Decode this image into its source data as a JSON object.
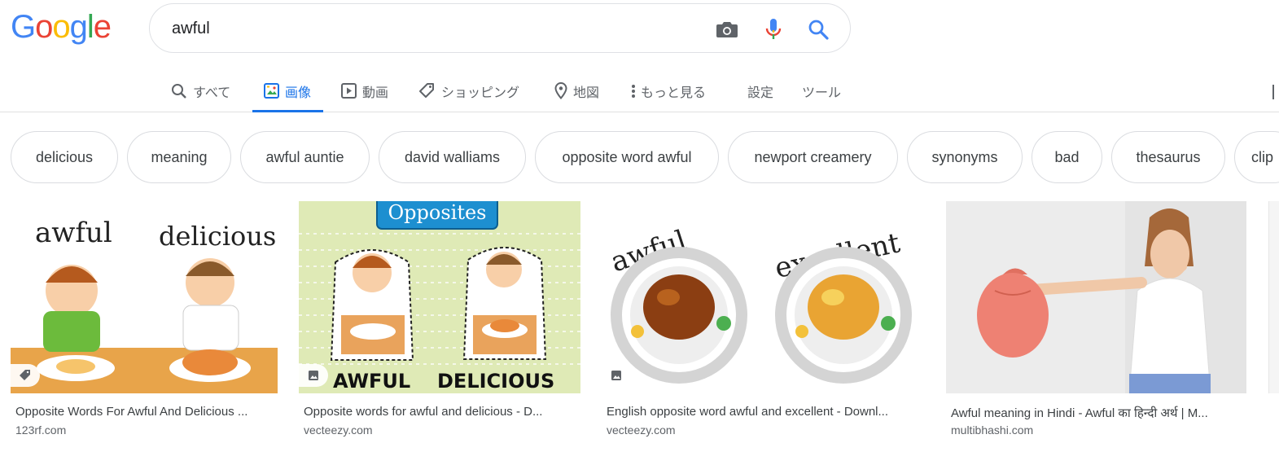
{
  "logo": {
    "letters": [
      "G",
      "o",
      "o",
      "g",
      "l",
      "e"
    ],
    "colors": [
      "#4285F4",
      "#EA4335",
      "#FBBC05",
      "#4285F4",
      "#34A853",
      "#EA4335"
    ]
  },
  "search": {
    "value": "awful",
    "icons": [
      "camera-icon",
      "microphone-icon",
      "search-icon"
    ]
  },
  "tabs": [
    {
      "label": "すべて",
      "icon": "search-icon"
    },
    {
      "label": "画像",
      "icon": "image-icon",
      "active": true
    },
    {
      "label": "動画",
      "icon": "video-icon"
    },
    {
      "label": "ショッピング",
      "icon": "tag-icon"
    },
    {
      "label": "地図",
      "icon": "map-pin-icon"
    },
    {
      "label": "もっと見る",
      "icon": "more-vert-icon"
    },
    {
      "label": "設定"
    },
    {
      "label": "ツール"
    }
  ],
  "chips": [
    "delicious",
    "meaning",
    "awful auntie",
    "david walliams",
    "opposite word awful",
    "newport creamery",
    "synonyms",
    "bad",
    "thesaurus",
    "clip"
  ],
  "results": [
    {
      "title": "Opposite Words For Awful And Delicious ...",
      "source": "123rf.com",
      "badge": "tag-icon",
      "image_text": [
        "awful",
        "delicious"
      ]
    },
    {
      "title": "Opposite words for awful and delicious - D...",
      "source": "vecteezy.com",
      "badge": "image-icon",
      "image_text": [
        "Opposites",
        "AWFUL",
        "DELICIOUS"
      ]
    },
    {
      "title": "English opposite word awful and excellent - Downl...",
      "source": "vecteezy.com",
      "badge": "image-icon",
      "image_text": [
        "awful",
        "excellent"
      ]
    },
    {
      "title": "Awful meaning in Hindi - Awful का हिन्दी अर्थ | M...",
      "source": "multibhashi.com"
    }
  ],
  "colors": {
    "accent": "#1a73e8",
    "tab_text": "#5f6368",
    "chip_border": "#dadce0"
  }
}
